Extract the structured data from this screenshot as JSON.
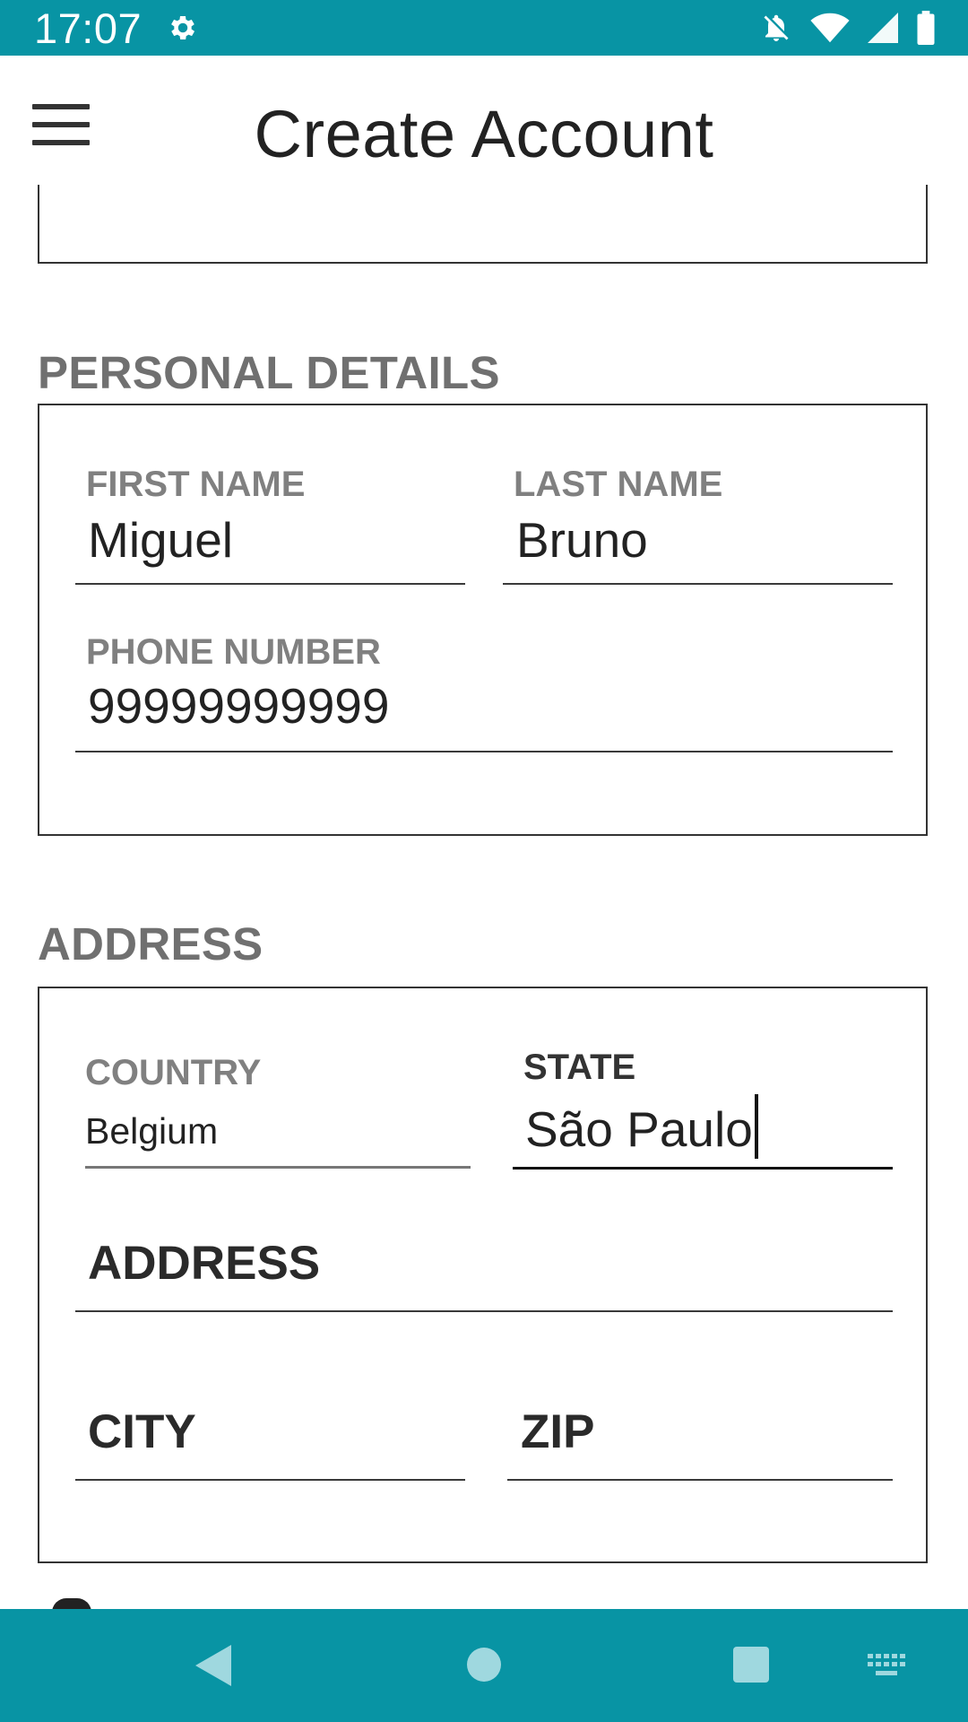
{
  "status_bar": {
    "time": "17:07",
    "icons": [
      "gear-icon",
      "notifications-off-icon",
      "wifi-icon",
      "signal-icon",
      "battery-icon"
    ]
  },
  "app_bar": {
    "title": "Create Account",
    "menu_icon": "hamburger-menu-icon"
  },
  "personal_details": {
    "section_title": "PERSONAL DETAILS",
    "first_name": {
      "label": "FIRST NAME",
      "value": "Miguel"
    },
    "last_name": {
      "label": "LAST NAME",
      "value": "Bruno"
    },
    "phone_number": {
      "label": "PHONE NUMBER",
      "value": "99999999999"
    }
  },
  "address": {
    "section_title": "ADDRESS",
    "country": {
      "label": "COUNTRY",
      "value": "Belgium"
    },
    "state": {
      "label": "STATE",
      "value": "São Paulo"
    },
    "address_field": {
      "placeholder": "ADDRESS"
    },
    "city": {
      "placeholder": "CITY"
    },
    "zip": {
      "placeholder": "ZIP"
    }
  },
  "nav_bar": {
    "icons": [
      "back-icon",
      "home-icon",
      "recents-icon",
      "keyboard-icon"
    ]
  },
  "colors": {
    "bar": "#0894a4",
    "nav_icon": "#9fd8df",
    "section_title": "#707070",
    "label": "#808080"
  }
}
